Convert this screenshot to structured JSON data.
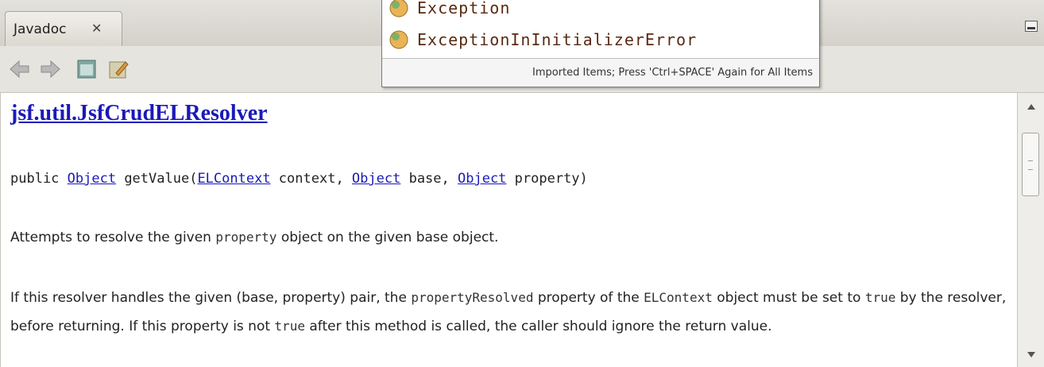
{
  "tab": {
    "label": "Javadoc",
    "close": "✕"
  },
  "toolbar": {
    "buttons": [
      "back-icon",
      "forward-icon",
      "show-source-icon",
      "open-in-browser-icon"
    ]
  },
  "doc": {
    "title": "jsf.util.JsfCrudELResolver",
    "signature": {
      "p1": "public ",
      "t1": "Object",
      "p2": " getValue(",
      "t2": "ELContext",
      "p3": " context, ",
      "t3": "Object",
      "p4": " base, ",
      "t4": "Object",
      "p5": " property)"
    },
    "para1": {
      "a": "Attempts to resolve the given ",
      "code": "property",
      "b": " object on the given base object."
    },
    "para2": {
      "a": "If this resolver handles the given (base, property) pair, the ",
      "code1": "propertyResolved",
      "b": " property of the ",
      "code2": "ELContext",
      "c": " object must be set to ",
      "code3": "true",
      "d": " by the resolver, before returning. If this property is not ",
      "code4": "true",
      "e": " after this method is called, the caller should ignore the return value."
    }
  },
  "popup": {
    "items": [
      {
        "label": "Exception",
        "icon": "class-icon"
      },
      {
        "label": "ExceptionInInitializerError",
        "icon": "class-icon"
      }
    ],
    "footer": "Imported Items; Press 'Ctrl+SPACE' Again for All Items"
  },
  "colors": {
    "link": "#1a1ab8",
    "popup_text": "#5a2a12"
  }
}
